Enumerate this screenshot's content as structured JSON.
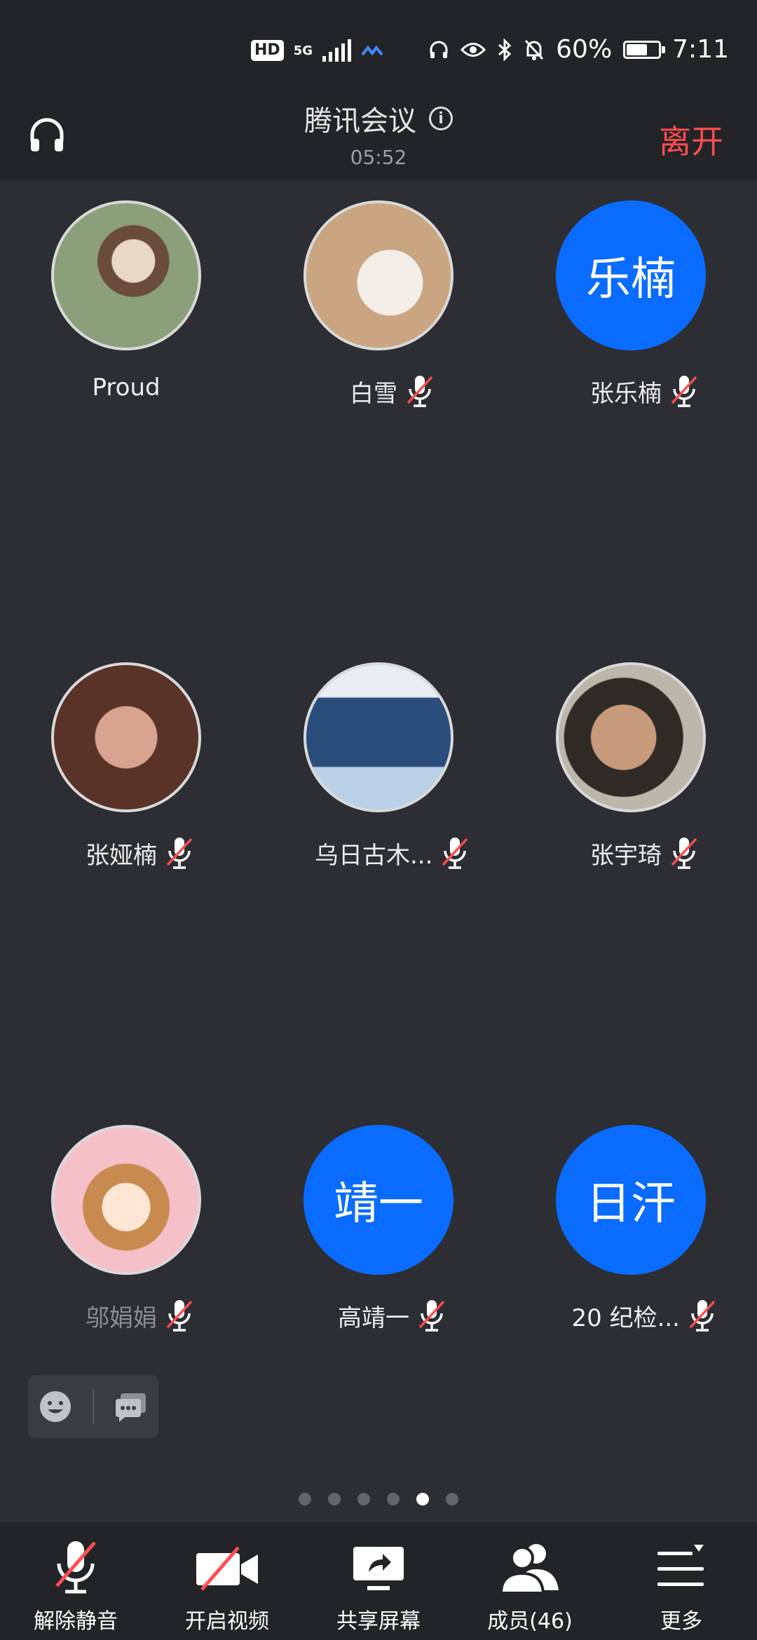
{
  "status_bar": {
    "hd": "HD",
    "network": "5G",
    "battery": "60%",
    "time": "7:11"
  },
  "header": {
    "title": "腾讯会议",
    "timer": "05:52",
    "leave_label": "离开"
  },
  "participants": [
    {
      "name": "Proud",
      "initials": "",
      "muted": false
    },
    {
      "name": "白雪",
      "initials": "",
      "muted": true
    },
    {
      "name": "张乐楠",
      "initials": "乐楠",
      "muted": true
    },
    {
      "name": "张娅楠",
      "initials": "",
      "muted": true
    },
    {
      "name": "乌日古木...",
      "initials": "",
      "muted": true
    },
    {
      "name": "张宇琦",
      "initials": "",
      "muted": true
    },
    {
      "name": "邬娟娟",
      "initials": "",
      "muted": true
    },
    {
      "name": "高靖一",
      "initials": "靖一",
      "muted": true
    },
    {
      "name": "20 纪检...",
      "initials": "日汗",
      "muted": true
    }
  ],
  "pager": {
    "total": 6,
    "current": 5
  },
  "toolbar": {
    "unmute_label": "解除静音",
    "video_label": "开启视频",
    "share_label": "共享屏幕",
    "members_label": "成员(46)",
    "more_label": "更多"
  },
  "colors": {
    "accent": "#0a6cff",
    "leave": "#ff4d4f",
    "mute_slash": "#ff4d4f",
    "background": "#2c2e33",
    "bar": "#222428"
  }
}
